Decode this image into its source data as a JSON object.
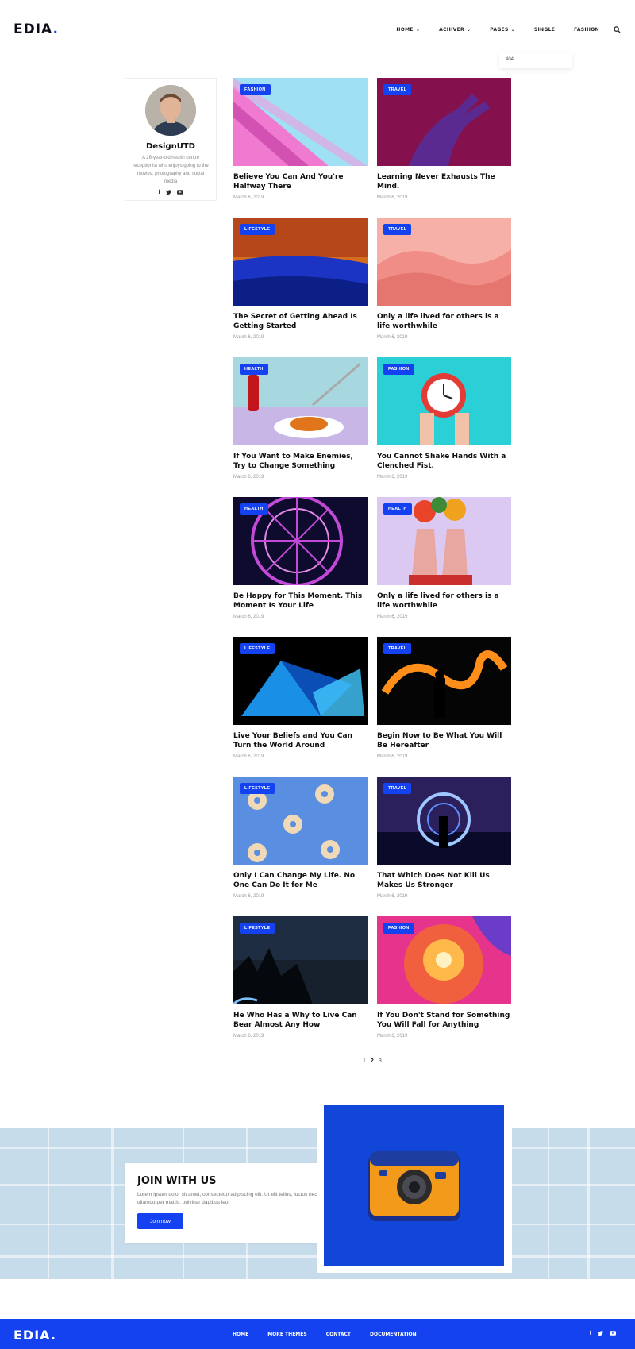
{
  "header": {
    "logo_main": "EDIA",
    "logo_dot": ".",
    "nav": [
      {
        "label": "HOME",
        "dropdown": true
      },
      {
        "label": "ACHIVER",
        "dropdown": true
      },
      {
        "label": "PAGES",
        "dropdown": true
      },
      {
        "label": "SINGLE",
        "dropdown": false
      },
      {
        "label": "FASHION",
        "dropdown": false
      }
    ],
    "dropdown_item": "404"
  },
  "author": {
    "name": "DesignUTD",
    "bio": "A 26-year-old health centre receptionist who enjoys going to the movies, photography and social media",
    "social": [
      "f",
      "t",
      "yt"
    ]
  },
  "posts": [
    {
      "category": "FASHION",
      "title": "Believe You Can And You're Halfway There",
      "date": "March 6, 2019"
    },
    {
      "category": "TRAVEL",
      "title": "Learning Never Exhausts The Mind.",
      "date": "March 6, 2019"
    },
    {
      "category": "LIFESTYLE",
      "title": "The Secret of Getting Ahead Is Getting Started",
      "date": "March 6, 2019"
    },
    {
      "category": "TRAVEL",
      "title": "Only a life lived for others is a life worthwhile",
      "date": "March 6, 2019"
    },
    {
      "category": "HEALTH",
      "title": "If You Want to Make Enemies, Try to Change Something",
      "date": "March 6, 2019"
    },
    {
      "category": "FASHION",
      "title": "You Cannot Shake Hands With a Clenched Fist.",
      "date": "March 6, 2019"
    },
    {
      "category": "HEALTH",
      "title": "Be Happy for This Moment. This Moment Is Your Life",
      "date": "March 6, 2019"
    },
    {
      "category": "HEALTH",
      "title": "Only a life lived for others is a life worthwhile",
      "date": "March 6, 2019"
    },
    {
      "category": "LIFESTYLE",
      "title": "Live Your Beliefs and You Can Turn the World Around",
      "date": "March 6, 2019"
    },
    {
      "category": "TRAVEL",
      "title": "Begin Now to Be What You Will Be Hereafter",
      "date": "March 6, 2019"
    },
    {
      "category": "LIFESTYLE",
      "title": "Only I Can Change My Life. No One Can Do It for Me",
      "date": "March 6, 2019"
    },
    {
      "category": "TRAVEL",
      "title": "That Which Does Not Kill Us Makes Us Stronger",
      "date": "March 6, 2019"
    },
    {
      "category": "LIFESTYLE",
      "title": "He Who Has a Why to Live Can Bear Almost Any How",
      "date": "March 6, 2019"
    },
    {
      "category": "FASHION",
      "title": "If You Don't Stand for Something You Will Fall for Anything",
      "date": "March 6, 2019"
    }
  ],
  "pagination": [
    "1",
    "2",
    "3"
  ],
  "join": {
    "title": "JOIN WITH US",
    "text": "Lorem ipsum dolor sit amet, consectetur adipiscing elit. Ut elit tellus, luctus nec ullamcorper mattis, pulvinar dapibus leo.",
    "button": "Join now"
  },
  "footer": {
    "logo_main": "EDIA",
    "logo_dot": ".",
    "links": [
      "HOME",
      "MORE THEMES",
      "CONTACT",
      "DOCUMENTATION"
    ],
    "social": [
      "f",
      "t",
      "yt"
    ]
  },
  "colors": {
    "accent": "#1442f0",
    "text": "#111111",
    "muted": "#999999"
  }
}
